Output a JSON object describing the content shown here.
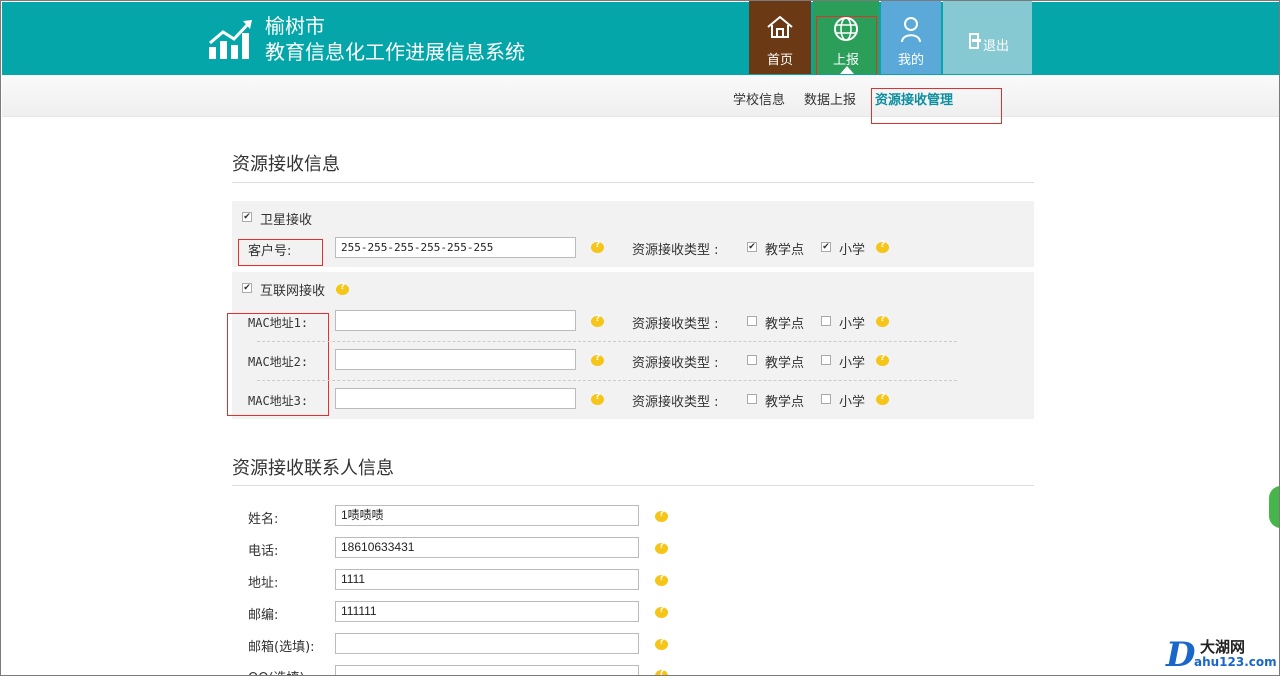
{
  "header": {
    "city": "榆树市",
    "system_title": "教育信息化工作进展信息系统",
    "nav": {
      "home": "首页",
      "report": "上报",
      "mine": "我的",
      "logout": "退出"
    }
  },
  "subnav": {
    "school_info": "学校信息",
    "data_report": "数据上报",
    "resource_mgmt": "资源接收管理"
  },
  "resource_section": {
    "title": "资源接收信息",
    "satellite": {
      "label": "卫星接收",
      "checked": true,
      "customer_no_label": "客户号:",
      "customer_no_value": "255-255-255-255-255-255",
      "type_label": "资源接收类型 :",
      "types": [
        {
          "label": "教学点",
          "checked": true
        },
        {
          "label": "小学",
          "checked": true
        }
      ]
    },
    "internet": {
      "label": "互联网接收",
      "checked": true,
      "rows": [
        {
          "label": "MAC地址1:",
          "value": "",
          "type_label": "资源接收类型 :",
          "t1": "教学点",
          "t2": "小学"
        },
        {
          "label": "MAC地址2:",
          "value": "",
          "type_label": "资源接收类型 :",
          "t1": "教学点",
          "t2": "小学"
        },
        {
          "label": "MAC地址3:",
          "value": "",
          "type_label": "资源接收类型 :",
          "t1": "教学点",
          "t2": "小学"
        }
      ]
    }
  },
  "contact_section": {
    "title": "资源接收联系人信息",
    "fields": [
      {
        "label": "姓名:",
        "value": "1啧啧啧"
      },
      {
        "label": "电话:",
        "value": "18610633431"
      },
      {
        "label": "地址:",
        "value": "1111"
      },
      {
        "label": "邮编:",
        "value": "111111"
      },
      {
        "label": "邮箱(选填):",
        "value": ""
      },
      {
        "label": "QQ(选填):",
        "value": ""
      }
    ]
  },
  "watermark": {
    "letter": "D",
    "cn": "大湖网",
    "en": "ahu123.com"
  },
  "colors": {
    "header_bg": "#04a6a9",
    "home_bg": "#6b3a15",
    "report_bg": "#2b9e5a",
    "mine_bg": "#5aa9d9",
    "logout_bg": "#86c9d3",
    "active_link": "#0e8fa0",
    "annotation_red": "#e03030"
  }
}
